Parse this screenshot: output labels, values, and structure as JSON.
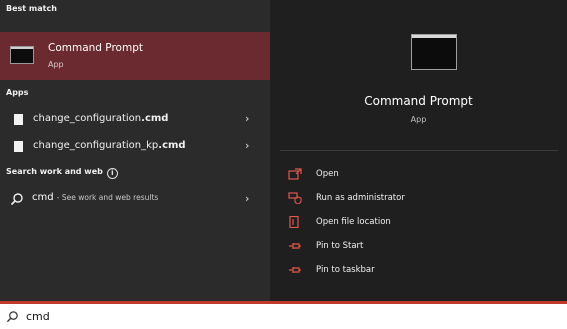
{
  "colors": {
    "accent": "#c0392b",
    "best_match_bg": "#6b2a2f",
    "left_bg": "#2b2b2b",
    "right_bg": "#1f1f1f"
  },
  "left": {
    "best_match_label": "Best match",
    "best_match": {
      "title": "Command Prompt",
      "subtitle": "App",
      "icon": "command-prompt-icon"
    },
    "apps_label": "Apps",
    "apps": [
      {
        "name_prefix": "change_configuration",
        "name_ext": ".cmd",
        "icon": "file-icon"
      },
      {
        "name_prefix": "change_configuration_kp",
        "name_ext": ".cmd",
        "icon": "file-icon"
      }
    ],
    "search_web_label": "Search work and web",
    "search_web": {
      "query": "cmd",
      "suffix": "- See work and web results"
    }
  },
  "right": {
    "title": "Command Prompt",
    "subtitle": "App",
    "actions": [
      {
        "label": "Open",
        "icon": "open-icon"
      },
      {
        "label": "Run as administrator",
        "icon": "shield-icon"
      },
      {
        "label": "Open file location",
        "icon": "folder-icon"
      },
      {
        "label": "Pin to Start",
        "icon": "pin-icon"
      },
      {
        "label": "Pin to taskbar",
        "icon": "pin-icon"
      }
    ]
  },
  "searchbar": {
    "value": "cmd"
  }
}
